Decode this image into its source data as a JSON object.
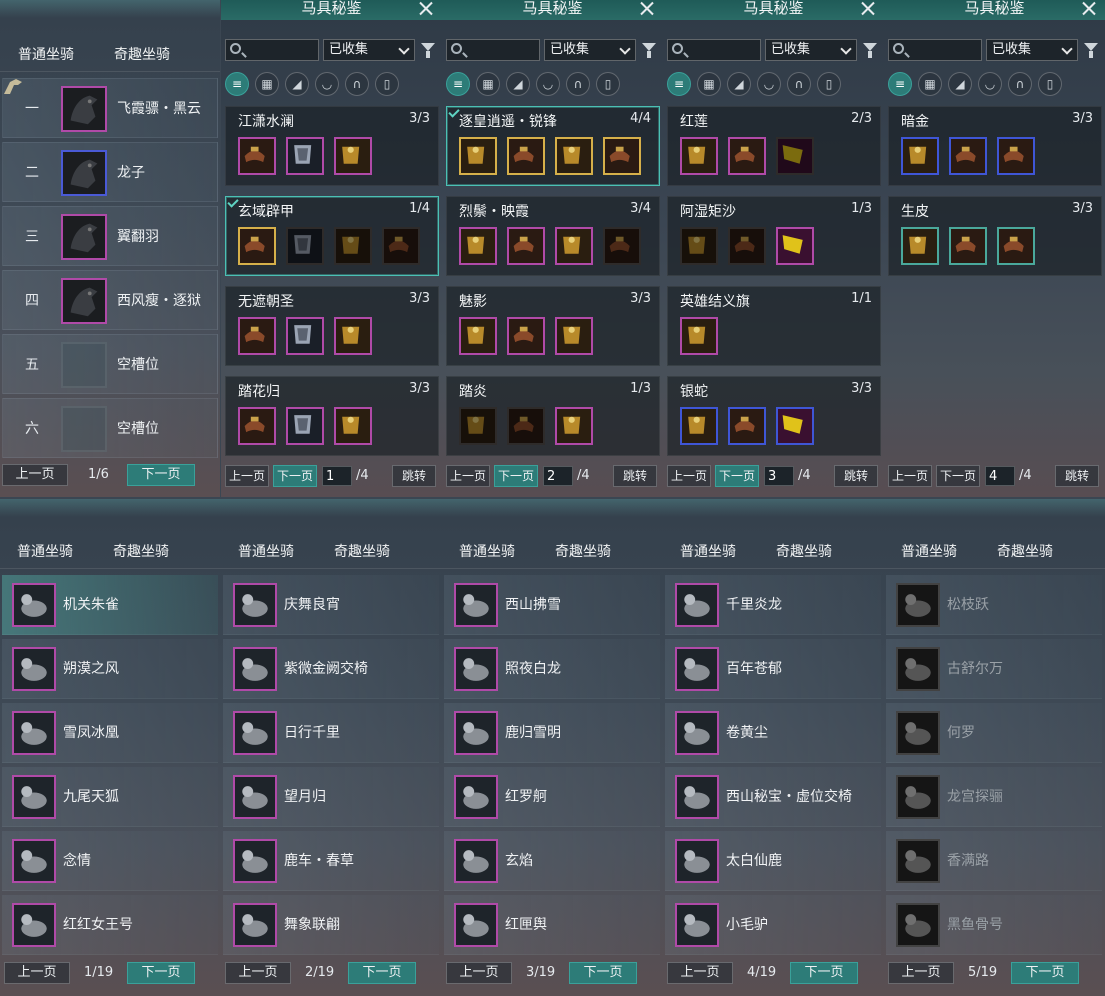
{
  "tabs": {
    "normal": "普通坐骑",
    "fun": "奇趣坐骑"
  },
  "slots": [
    {
      "num": "一",
      "name": "飞霞骠・黑云",
      "frame": "purple"
    },
    {
      "num": "二",
      "name": "龙子",
      "frame": "blue"
    },
    {
      "num": "三",
      "name": "翼翻羽",
      "frame": "purple"
    },
    {
      "num": "四",
      "name": "西风瘦・逐狱",
      "frame": "purple"
    },
    {
      "num": "五",
      "name": "空槽位",
      "frame": "empty"
    },
    {
      "num": "六",
      "name": "空槽位",
      "frame": "empty"
    }
  ],
  "pager": {
    "prev": "上一页",
    "next": "下一页",
    "jump": "跳转",
    "slot_page": "1/6"
  },
  "catalog": {
    "title": "马具秘鉴",
    "filter_value": "已收集",
    "search_placeholder": "",
    "pages": [
      {
        "page": "1",
        "total": "/4",
        "sets": [
          {
            "name": "江潇水澜",
            "count": "3/3",
            "frames": [
              "purple",
              "purple",
              "purple"
            ]
          },
          {
            "name": "玄域辟甲",
            "count": "1/4",
            "selected": true,
            "frames": [
              "gold",
              "dim",
              "dim",
              "dim"
            ]
          },
          {
            "name": "无遮朝圣",
            "count": "3/3",
            "frames": [
              "purple",
              "purple",
              "purple"
            ]
          },
          {
            "name": "踏花归",
            "count": "3/3",
            "frames": [
              "purple",
              "purple",
              "purple"
            ]
          }
        ]
      },
      {
        "page": "2",
        "total": "/4",
        "sets": [
          {
            "name": "逐皇逍遥・锐锋",
            "count": "4/4",
            "selected": true,
            "frames": [
              "gold",
              "gold",
              "gold",
              "gold"
            ]
          },
          {
            "name": "烈鬃・映霞",
            "count": "3/4",
            "frames": [
              "purple",
              "purple",
              "purple",
              "dim"
            ]
          },
          {
            "name": "魅影",
            "count": "3/3",
            "frames": [
              "purple",
              "purple",
              "purple"
            ]
          },
          {
            "name": "踏炎",
            "count": "1/3",
            "frames": [
              "dim",
              "dim",
              "purple"
            ]
          }
        ]
      },
      {
        "page": "3",
        "total": "/4",
        "sets": [
          {
            "name": "红莲",
            "count": "2/3",
            "frames": [
              "purple",
              "purple",
              "dim"
            ]
          },
          {
            "name": "阿湿矩沙",
            "count": "1/3",
            "frames": [
              "dim",
              "dim",
              "purple"
            ]
          },
          {
            "name": "英雄结义旗",
            "count": "1/1",
            "frames": [
              "purple"
            ]
          },
          {
            "name": "银蛇",
            "count": "3/3",
            "frames": [
              "blue",
              "blue",
              "blue"
            ]
          }
        ]
      },
      {
        "page": "4",
        "total": "/4",
        "sets": [
          {
            "name": "暗金",
            "count": "3/3",
            "frames": [
              "blue",
              "blue",
              "blue"
            ]
          },
          {
            "name": "生皮",
            "count": "3/3",
            "frames": [
              "teal",
              "teal",
              "teal"
            ]
          }
        ]
      }
    ]
  },
  "fun_pages": [
    {
      "page": "1/19",
      "items": [
        {
          "name": "机关朱雀",
          "sel": true
        },
        {
          "name": "朔漠之风"
        },
        {
          "name": "雪凤冰凰"
        },
        {
          "name": "九尾天狐"
        },
        {
          "name": "念情"
        },
        {
          "name": "红红女王号"
        }
      ]
    },
    {
      "page": "2/19",
      "items": [
        {
          "name": "庆舞良宵"
        },
        {
          "name": "紫微金阙交椅"
        },
        {
          "name": "日行千里"
        },
        {
          "name": "望月归"
        },
        {
          "name": "鹿车・春草"
        },
        {
          "name": "舞象联翩"
        }
      ]
    },
    {
      "page": "3/19",
      "items": [
        {
          "name": "西山拂雪"
        },
        {
          "name": "照夜白龙"
        },
        {
          "name": "鹿归雪明"
        },
        {
          "name": "红罗舸"
        },
        {
          "name": "玄焰"
        },
        {
          "name": "红匣舆"
        }
      ]
    },
    {
      "page": "4/19",
      "items": [
        {
          "name": "千里炎龙"
        },
        {
          "name": "百年苍郁"
        },
        {
          "name": "卷黄尘"
        },
        {
          "name": "西山秘宝・虚位交椅"
        },
        {
          "name": "太白仙鹿"
        },
        {
          "name": "小毛驴"
        }
      ]
    },
    {
      "page": "5/19",
      "items": [
        {
          "name": "松枝跃",
          "gray": true
        },
        {
          "name": "古舒尔万",
          "gray": true
        },
        {
          "name": "何罗",
          "gray": true
        },
        {
          "name": "龙宫探骊",
          "gray": true
        },
        {
          "name": "香满路",
          "gray": true
        },
        {
          "name": "黑鱼骨号",
          "gray": true
        }
      ]
    }
  ],
  "colors": {
    "teal_button": "#2d7c78",
    "purple_frame": "#b04aa8",
    "gold_frame": "#d6b04a",
    "blue_frame": "#3f56d6"
  }
}
